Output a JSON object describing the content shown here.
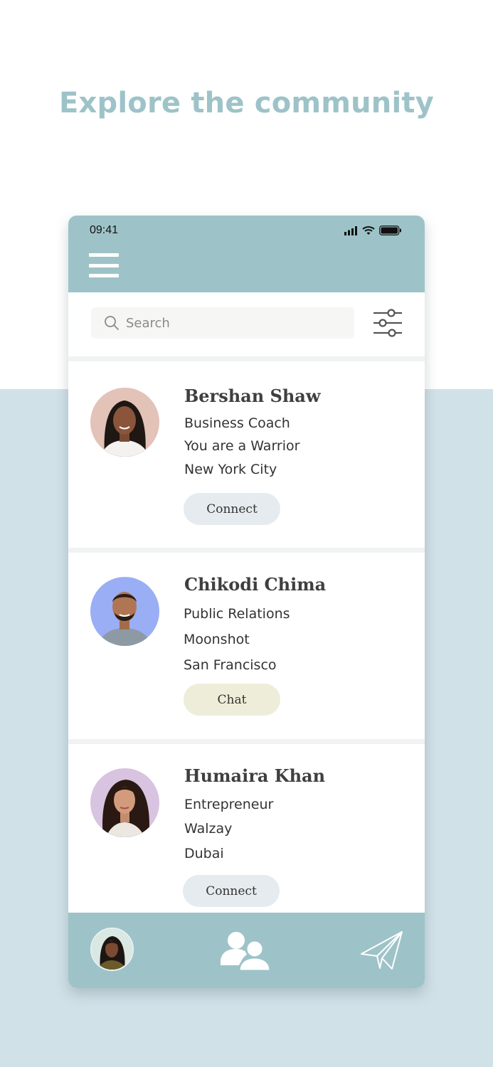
{
  "headline": "Explore the community",
  "status_bar": {
    "time": "09:41"
  },
  "search": {
    "placeholder": "Search",
    "value": ""
  },
  "profiles": [
    {
      "name": "Bershan Shaw",
      "title": "Business Coach",
      "company": "You are a Warrior",
      "location": "New York City",
      "action": "Connect"
    },
    {
      "name": "Chikodi Chima",
      "title": "Public Relations",
      "company": "Moonshot",
      "location": "San Francisco",
      "action": "Chat"
    },
    {
      "name": "Humaira Khan",
      "title": "Entrepreneur",
      "company": "Walzay",
      "location": "Dubai",
      "action": "Connect"
    }
  ],
  "icons": {
    "menu": "hamburger-menu-icon",
    "search": "search-icon",
    "filter": "sliders-filter-icon",
    "community": "people-icon",
    "messages": "paper-plane-icon"
  },
  "colors": {
    "accent": "#9dc3c8",
    "headline": "#9dc3c8",
    "background_lower": "#d1e1e8",
    "connect_button": "#e5ebee",
    "chat_button": "#ededd9"
  }
}
